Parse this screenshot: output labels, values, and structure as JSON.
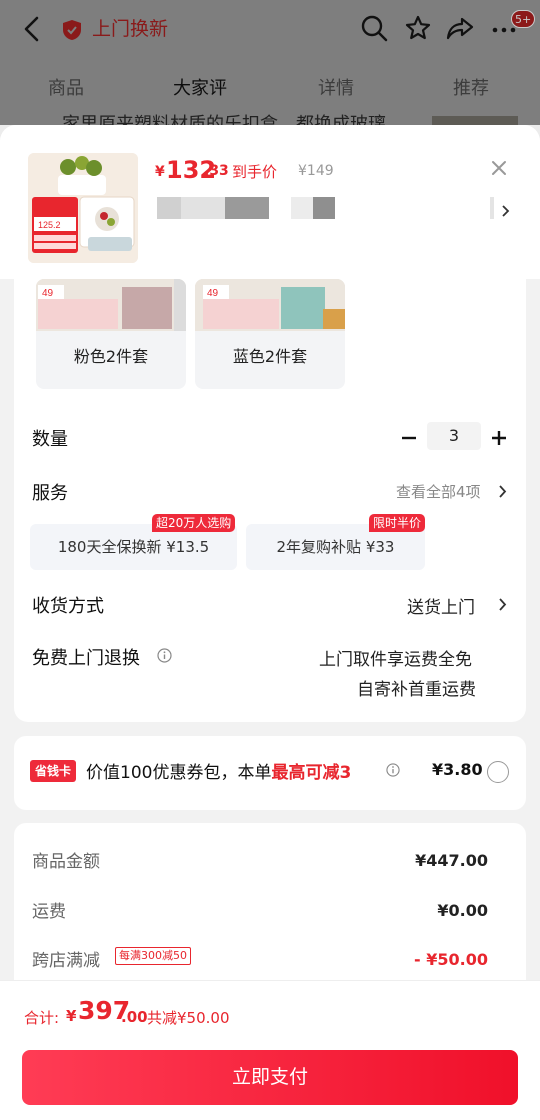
{
  "header": {
    "title": "上门换新",
    "cart_badge": "5+",
    "tabs": [
      "商品",
      "大家评",
      "详情",
      "推荐"
    ],
    "peek_text": "家里原来塑料材质的乐扣盒，都换成玻璃"
  },
  "summary": {
    "price_symbol": "¥",
    "price_int": "132",
    "price_dec": ".33",
    "price_label": "到手价",
    "original_price": "¥149",
    "thumb_badge_price": "125.2"
  },
  "options": [
    {
      "label": "粉色2件套",
      "badge": "49"
    },
    {
      "label": "蓝色2件套",
      "badge": "49"
    }
  ],
  "quantity": {
    "label": "数量",
    "value": "3"
  },
  "service": {
    "label": "服务",
    "see_all": "查看全部4项",
    "items": [
      {
        "text": "180天全保换新 ¥13.5",
        "tag": "超20万人选购"
      },
      {
        "text": "2年复购补贴 ¥33",
        "tag": "限时半价"
      }
    ]
  },
  "delivery": {
    "label": "收货方式",
    "value": "送货上门"
  },
  "return": {
    "label": "免费上门退换",
    "line1": "上门取件享运费全免",
    "line2": "自寄补首重运费"
  },
  "coupon": {
    "badge": "省钱卡",
    "text_plain": "价值100优惠券包，本单",
    "text_red": "最高可减3",
    "amount": "¥3.80"
  },
  "fees": {
    "goods_label": "商品金额",
    "goods_value": "¥447.00",
    "shipping_label": "运费",
    "shipping_value": "¥0.00",
    "cross_label": "跨店满减",
    "cross_tag": "每满300减50",
    "cross_value": "- ¥50.00"
  },
  "footer": {
    "total_label": "合计:",
    "total_symbol": "¥",
    "total_int": "397",
    "total_dec": ".00",
    "saved": "共减¥50.00",
    "pay_label": "立即支付"
  },
  "colors": {
    "accent": "#e8262e",
    "overlay": "#7e7e7e"
  }
}
